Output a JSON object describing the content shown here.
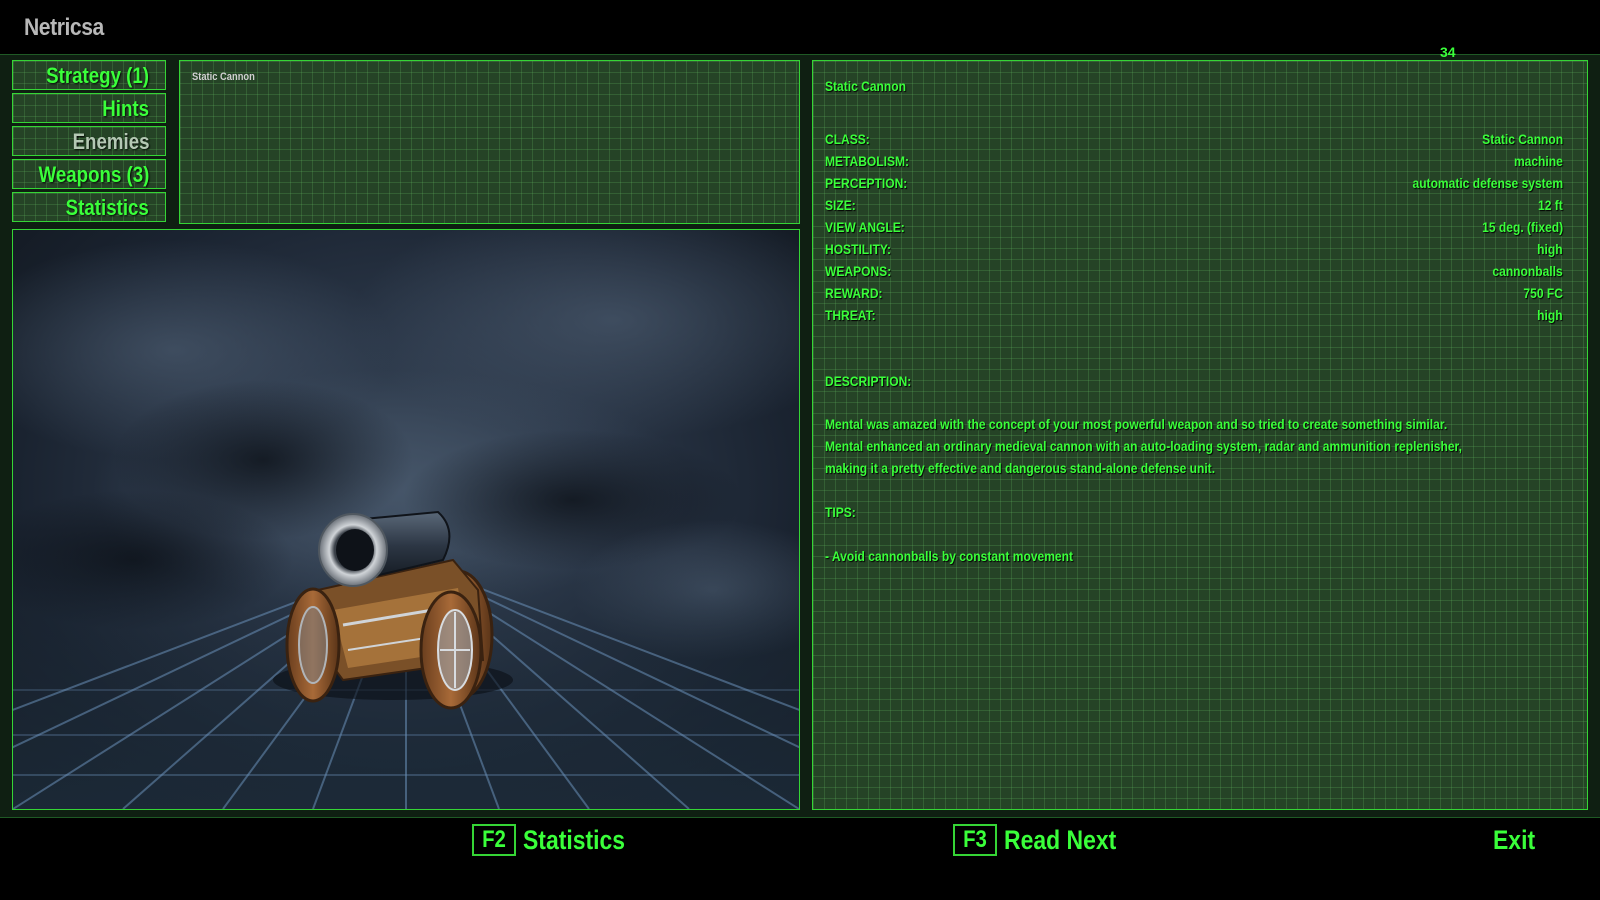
{
  "app": {
    "title": "Netricsa",
    "page_number": "34"
  },
  "tabs": [
    {
      "label": "Strategy (1)",
      "active": true
    },
    {
      "label": "Hints",
      "active": true
    },
    {
      "label": "Enemies",
      "active": false
    },
    {
      "label": "Weapons (3)",
      "active": true
    },
    {
      "label": "Statistics",
      "active": true
    }
  ],
  "list": {
    "items": [
      "Static Cannon"
    ]
  },
  "info": {
    "name": "Static Cannon",
    "stats": [
      {
        "label": "CLASS:",
        "value": "Static Cannon"
      },
      {
        "label": "METABOLISM:",
        "value": "machine"
      },
      {
        "label": "PERCEPTION:",
        "value": "automatic defense system"
      },
      {
        "label": "SIZE:",
        "value": "12 ft"
      },
      {
        "label": "VIEW ANGLE:",
        "value": "15 deg. (fixed)"
      },
      {
        "label": "HOSTILITY:",
        "value": "high"
      },
      {
        "label": "WEAPONS:",
        "value": "cannonballs"
      },
      {
        "label": "REWARD:",
        "value": "750 FC"
      },
      {
        "label": "THREAT:",
        "value": "high"
      }
    ],
    "description_label": "DESCRIPTION:",
    "description_lines": [
      "Mental was amazed with the concept of your most powerful weapon and so tried to create something similar.",
      "Mental enhanced an ordinary medieval cannon with an auto-loading system, radar and ammunition replenisher,",
      "making it a pretty effective and dangerous stand-alone defense unit."
    ],
    "tips_label": "TIPS:",
    "tips": [
      "- Avoid cannonballs by constant movement"
    ]
  },
  "footer": {
    "statistics_key": "F2",
    "statistics_label": "Statistics",
    "next_key": "F3",
    "next_label": "Read Next",
    "exit_label": "Exit"
  },
  "colors": {
    "accent_green": "#3aff3a",
    "border_green": "#35d535",
    "panel_bg": "#254326",
    "dim_text": "#b4c8b4"
  }
}
